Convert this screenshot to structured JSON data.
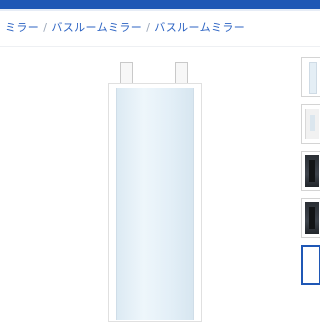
{
  "breadcrumb": {
    "items": [
      "ミラー",
      "バスルームミラー",
      "バスルームミラー"
    ],
    "separator": "/"
  },
  "gallery": {
    "main_image": "mirror-product-image",
    "thumbnails": [
      "mirror-front",
      "mirror-in-room",
      "mirror-dark-room",
      "mirror-dark-room",
      "mirror-selected"
    ],
    "selected_thumbnail": 4
  },
  "colors": {
    "accent": "#1f57b5"
  }
}
